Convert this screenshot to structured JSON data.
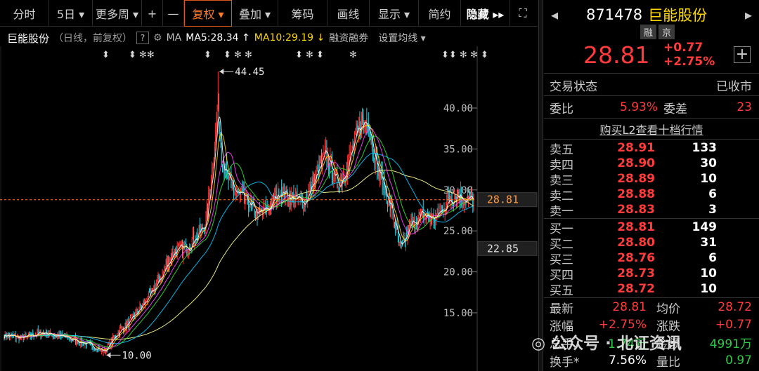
{
  "toolbar": {
    "items": [
      "分时",
      "5日 ▾",
      "更多周 ▾",
      "+",
      "—",
      "复权 ▾",
      "叠加 ▾",
      "筹码",
      "画线",
      "显示 ▾",
      "简约",
      "隐藏 ▸▸",
      "⛶"
    ]
  },
  "header": {
    "stock_name": "巨能股份",
    "period": "（日线，前复权）",
    "help": "?",
    "ma_label": "MA",
    "ma5": "MA5:28.34 ↑",
    "ma10": "MA10:29.19 ↓",
    "margin": "融资融券",
    "setting": "设置均线 ▾"
  },
  "chart_data": {
    "type": "candlestick",
    "ylim": [
      10,
      47
    ],
    "y_ticks": [
      40,
      35,
      30,
      25,
      20,
      15
    ],
    "y_tick_labels": [
      "40.00",
      "35.00",
      "30.00",
      "25.00",
      "20.00",
      "15.00"
    ],
    "price_tags": [
      {
        "label": "28.81",
        "value": 28.81
      },
      {
        "label": "22.85",
        "value": 22.85
      }
    ],
    "high_annotation": "44.45",
    "low_annotation": "10.00",
    "high_value": 44.45,
    "low_value": 10.0,
    "event_marks": [
      "⬍",
      "⬍ ✻✻",
      "⬍",
      "⬍ ✻ ✻",
      "⬍ ✻ ⬍",
      "✻",
      "⬍⬍ ✻ ✻ ⬍"
    ],
    "colors": {
      "up": "#ff3030",
      "down": "#20d0e0",
      "ma5": "#ffffff",
      "ma10": "#ffd800",
      "ma20": "#ff40ff",
      "ma30": "#30e030",
      "ma60": "#00c8ff",
      "ma120": "#ffff90"
    }
  },
  "panel": {
    "code": "871478",
    "name": "巨能股份",
    "badges": [
      "融",
      "京"
    ],
    "price": "28.81",
    "change": "+0.77",
    "change_pct": "+2.75%",
    "plus": "+",
    "trade_status_label": "交易状态",
    "trade_status": "已收市",
    "weibi_label": "委比",
    "weibi": "5.93%",
    "weicha_label": "委差",
    "weicha": "23",
    "l2_link": "购买L2查看十档行情",
    "asks": [
      {
        "label": "卖五",
        "price": "28.91",
        "vol": "133"
      },
      {
        "label": "卖四",
        "price": "28.90",
        "vol": "30"
      },
      {
        "label": "卖三",
        "price": "28.89",
        "vol": "10"
      },
      {
        "label": "卖二",
        "price": "28.88",
        "vol": "6"
      },
      {
        "label": "卖一",
        "price": "28.83",
        "vol": "3"
      }
    ],
    "bids": [
      {
        "label": "买一",
        "price": "28.81",
        "vol": "149"
      },
      {
        "label": "买二",
        "price": "28.80",
        "vol": "31"
      },
      {
        "label": "买三",
        "price": "28.76",
        "vol": "6"
      },
      {
        "label": "买四",
        "price": "28.73",
        "vol": "10"
      },
      {
        "label": "买五",
        "price": "28.72",
        "vol": "10"
      }
    ],
    "latest_label": "最新",
    "latest": "28.81",
    "avg_label": "均价",
    "avg": "28.72",
    "zf_label": "涨幅",
    "zf": "+2.75%",
    "zd_label": "涨跌",
    "zd": "+0.77",
    "vol_label": "总手",
    "vol": "1.74万",
    "amount_label": "金额",
    "amount": "4991万",
    "hs_label": "换手*",
    "hs": "7.56%",
    "lb_label": "量比",
    "lb": "0.97"
  },
  "watermark": "公众号 · 北证资讯"
}
